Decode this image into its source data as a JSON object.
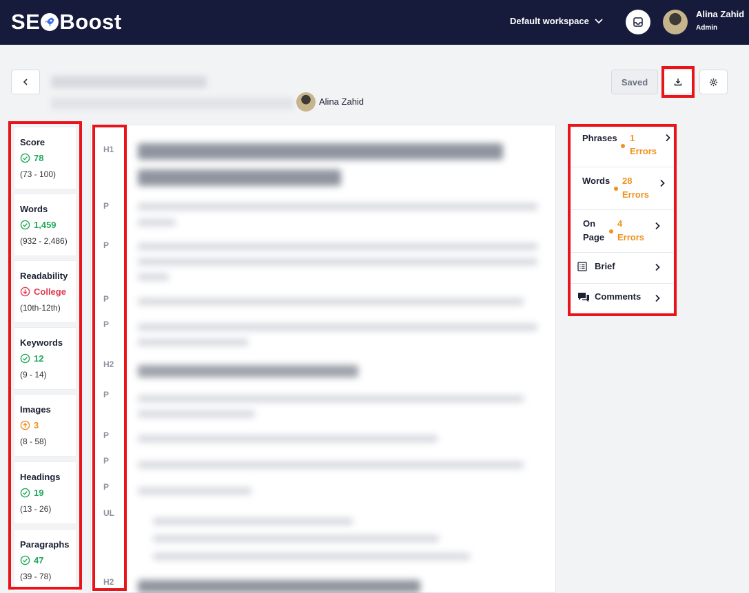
{
  "app": {
    "logo_text_left": "SE",
    "logo_text_right": "Boost",
    "workspace": "Default workspace",
    "user": {
      "name": "Alina Zahid",
      "role": "Admin"
    }
  },
  "toolbar": {
    "back_icon": "chevron-left",
    "author": "Alina Zahid",
    "saved_label": "Saved",
    "download_icon": "download",
    "settings_icon": "gear"
  },
  "metrics": [
    {
      "label": "Score",
      "value": "78",
      "range": "(73 - 100)",
      "status": "ok",
      "color": "#1fa85a"
    },
    {
      "label": "Words",
      "value": "1,459",
      "range": "(932 - 2,486)",
      "status": "ok",
      "color": "#1fa85a"
    },
    {
      "label": "Readability",
      "value": "College",
      "range": "(10th-12th)",
      "status": "down",
      "color": "#e03b52"
    },
    {
      "label": "Keywords",
      "value": "12",
      "range": "(9 - 14)",
      "status": "ok",
      "color": "#1fa85a"
    },
    {
      "label": "Images",
      "value": "3",
      "range": "(8 - 58)",
      "status": "up",
      "color": "#f0901e"
    },
    {
      "label": "Headings",
      "value": "19",
      "range": "(13 - 26)",
      "status": "ok",
      "color": "#1fa85a"
    },
    {
      "label": "Paragraphs",
      "value": "47",
      "range": "(39 - 78)",
      "status": "ok",
      "color": "#1fa85a"
    }
  ],
  "editor": {
    "tags": [
      "H1",
      "P",
      "P",
      "P",
      "P",
      "H2",
      "P",
      "P",
      "P",
      "P",
      "UL",
      "H2"
    ]
  },
  "right_panel": {
    "phrases": {
      "label": "Phrases",
      "count": "1",
      "unit": "Errors"
    },
    "words": {
      "label": "Words",
      "count": "28",
      "unit": "Errors"
    },
    "on_page": {
      "label_line1": "On",
      "label_line2": "Page",
      "count": "4",
      "unit": "Errors"
    },
    "brief": {
      "label": "Brief"
    },
    "comments": {
      "label": "Comments"
    }
  }
}
